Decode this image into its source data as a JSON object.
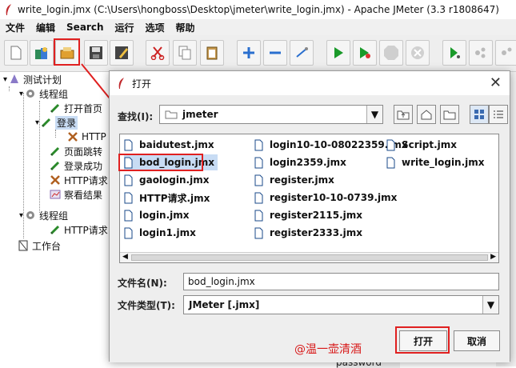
{
  "window": {
    "title": "write_login.jmx (C:\\Users\\hongboss\\Desktop\\jmeter\\write_login.jmx) - Apache JMeter (3.3 r1808647)"
  },
  "menu": [
    "文件",
    "编辑",
    "Search",
    "运行",
    "选项",
    "帮助"
  ],
  "toolbar": {
    "icons": [
      "new-icon",
      "templates-icon",
      "open-icon",
      "save-icon",
      "save-as-icon",
      "cut-icon",
      "copy-icon",
      "paste-icon",
      "expand-icon",
      "collapse-icon",
      "toggle-icon",
      "start-icon",
      "start-no-pause-icon",
      "stop-icon",
      "shutdown-icon",
      "remote-start-icon",
      "remote-stop-icon",
      "remote-exit-icon"
    ]
  },
  "tree": {
    "nodes": [
      {
        "label": "测试计划"
      },
      {
        "label": "线程组"
      },
      {
        "label": "打开首页"
      },
      {
        "label": "登录"
      },
      {
        "label": "HTTP"
      },
      {
        "label": "页面跳转"
      },
      {
        "label": "登录成功"
      },
      {
        "label": "HTTP请求"
      },
      {
        "label": "察看结果"
      },
      {
        "label": "线程组"
      },
      {
        "label": "HTTP请求"
      },
      {
        "label": "工作台"
      }
    ]
  },
  "dialog": {
    "title": "打开",
    "look_in_label": "查找(I):",
    "look_in_value": "jmeter",
    "files": [
      "baidutest.jmx",
      "bod_login.jmx",
      "gaologin.jmx",
      "HTTP请求.jmx",
      "login.jmx",
      "login1.jmx",
      "login10-10-08022359.jmx",
      "login2359.jmx",
      "register.jmx",
      "register10-10-0739.jmx",
      "register2115.jmx",
      "register2333.jmx",
      "Script.jmx",
      "write_login.jmx"
    ],
    "filename_label": "文件名(N):",
    "filename_value": "bod_login.jmx",
    "filetype_label": "文件类型(T):",
    "filetype_value": "JMeter [.jmx]",
    "open_button": "打开",
    "cancel_button": "取消"
  },
  "watermark": "@温一壶清酒",
  "background_text": "password",
  "colors": {
    "highlight": "#e02020",
    "selection": "#c8dcf4",
    "tree_selection": "#c8dcf4"
  }
}
